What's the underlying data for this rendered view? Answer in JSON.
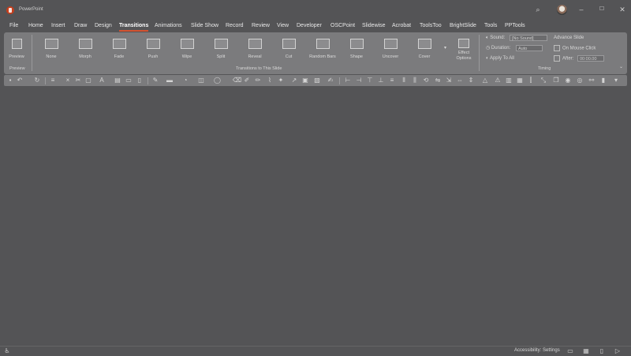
{
  "window": {
    "title": "PowerPoint",
    "controls": [
      "search-icon",
      "minimize-icon",
      "restore-icon",
      "close-icon"
    ]
  },
  "tabs": [
    "File",
    "Home",
    "Insert",
    "Draw",
    "Design",
    "Transitions",
    "Animations",
    "Slide Show",
    "Record",
    "Review",
    "View",
    "Developer",
    "OSCPoint",
    "Slidewise",
    "Acrobat",
    "ToolsToo",
    "BrightSlide",
    "Tools",
    "PPTools"
  ],
  "active_tab": "Transitions",
  "ribbon": {
    "preview": {
      "button": "Preview",
      "group": "Preview"
    },
    "transitions": [
      "None",
      "Morph",
      "Fade",
      "Push",
      "Wipe",
      "Split",
      "Reveal",
      "Cut",
      "Random Bars",
      "Shape",
      "Uncover",
      "Cover"
    ],
    "group_transitions": "Transitions to This Slide",
    "effect_options": "Effect Options",
    "timing": {
      "sound_label": "Sound:",
      "sound_value": "[No Sound]",
      "duration_label": "Duration:",
      "duration_value": "Auto",
      "apply_all": "Apply To All",
      "advance_header": "Advance Slide",
      "on_mouse_click": "On Mouse Click",
      "after_label": "After:",
      "after_value": "00:00.00",
      "group": "Timing"
    }
  },
  "status": {
    "accessibility": "Accessibility: Settings",
    "accent": "#d35230"
  }
}
